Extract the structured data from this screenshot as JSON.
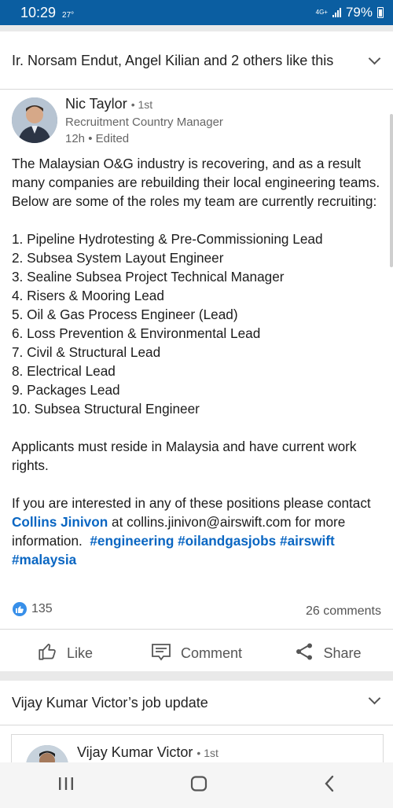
{
  "status_bar": {
    "time": "10:29",
    "temperature": "27°",
    "network": "4G+",
    "battery": "79%"
  },
  "post1": {
    "header": "Ir. Norsam Endut, Angel Kilian and 2 others like this",
    "author": {
      "name": "Nic Taylor",
      "degree": "1st",
      "title": "Recruitment Country Manager",
      "time": "12h • Edited"
    },
    "intro": "The Malaysian O&G industry is recovering, and as a result many companies are rebuilding their local engineering teams. Below are some of the roles my team are currently recruiting:",
    "roles": [
      "1. Pipeline Hydrotesting & Pre-Commissioning Lead",
      "2. Subsea System Layout Engineer",
      "3. Sealine Subsea Project Technical Manager",
      "4. Risers & Mooring Lead",
      "5. Oil & Gas Process Engineer (Lead)",
      "6. Loss Prevention & Environmental Lead",
      "7. Civil & Structural Lead",
      "8. Electrical Lead",
      "9. Packages Lead",
      "10. Subsea Structural Engineer"
    ],
    "requirement": "Applicants must reside in Malaysia and have current work rights.",
    "contact_pre": "If you are interested in any of these positions please contact ",
    "contact_name": "Collins Jinivon",
    "contact_post": " at collins.jinivon@airswift.com for more information.",
    "hashtags": [
      "#engineering",
      "#oilandgasjobs",
      "#airswift",
      "#malaysia"
    ],
    "reaction_count": "135",
    "comment_count": "26 comments",
    "actions": {
      "like": "Like",
      "comment": "Comment",
      "share": "Share"
    }
  },
  "post2": {
    "header": "Vijay Kumar Victor’s job update",
    "author": {
      "name": "Vijay Kumar Victor",
      "degree": "1st"
    }
  },
  "colors": {
    "status_bar": "#0b5ea1",
    "link": "#0a66c2",
    "reaction": "#378fe9"
  },
  "icons": [
    "thumbs-up-icon",
    "comment-icon",
    "share-icon",
    "chevron-down-icon",
    "recents-icon",
    "home-icon",
    "back-icon"
  ]
}
